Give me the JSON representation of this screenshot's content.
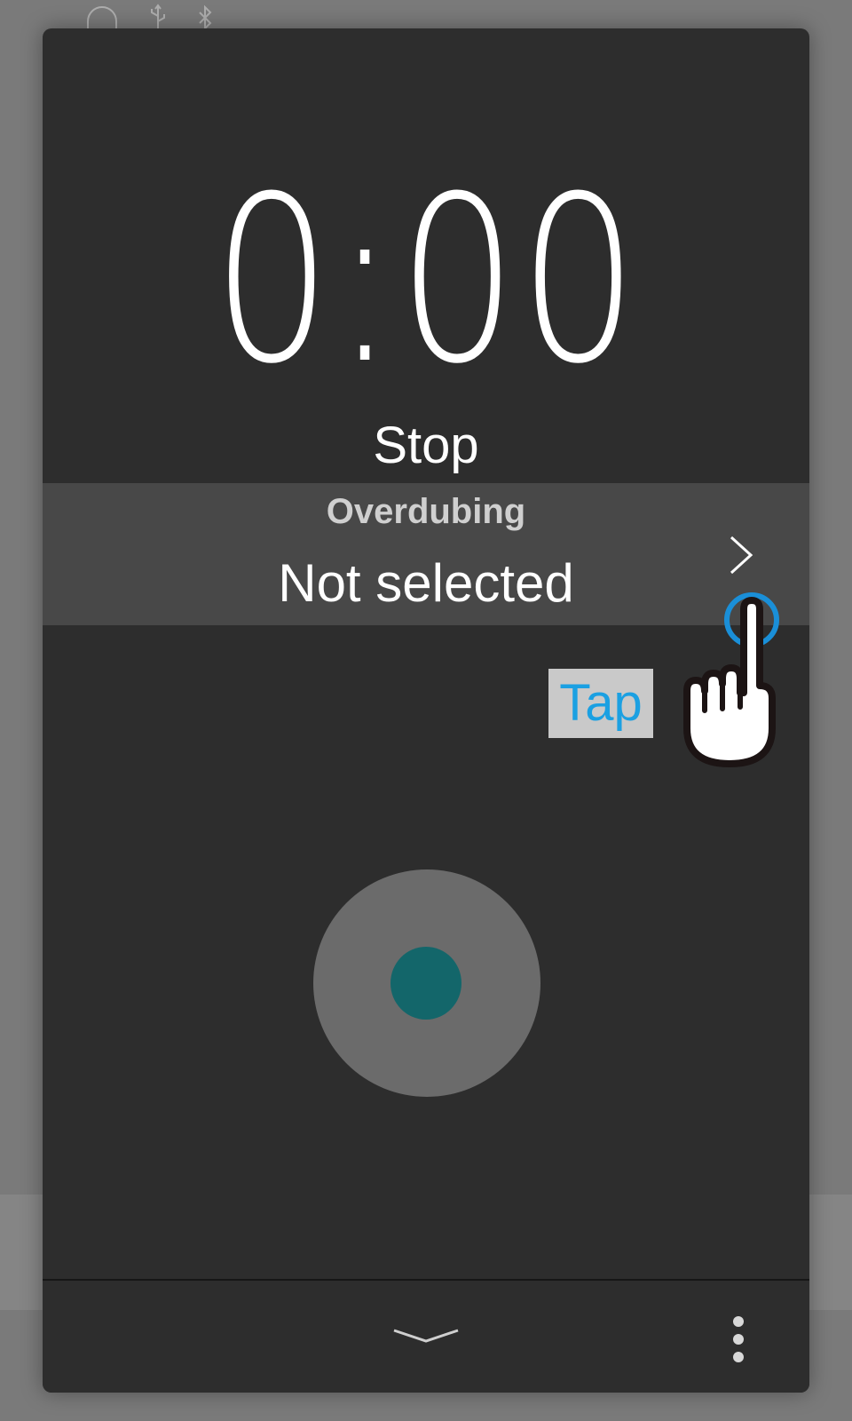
{
  "status_bar": {
    "icons": [
      "headphones-icon",
      "usb-icon",
      "bluetooth-icon"
    ]
  },
  "recorder": {
    "time": "0:00",
    "state": "Stop",
    "overdub": {
      "title": "Overdubing",
      "value": "Not selected"
    }
  },
  "tutorial": {
    "tap_label": "Tap"
  },
  "colors": {
    "panel_background": "#2d2d2d",
    "overdub_row_background": "#484848",
    "record_button_outer": "#6b6b6b",
    "record_button_inner": "#13666a",
    "tap_text": "#1ba0e2",
    "tap_ring": "#1a8fd8"
  }
}
